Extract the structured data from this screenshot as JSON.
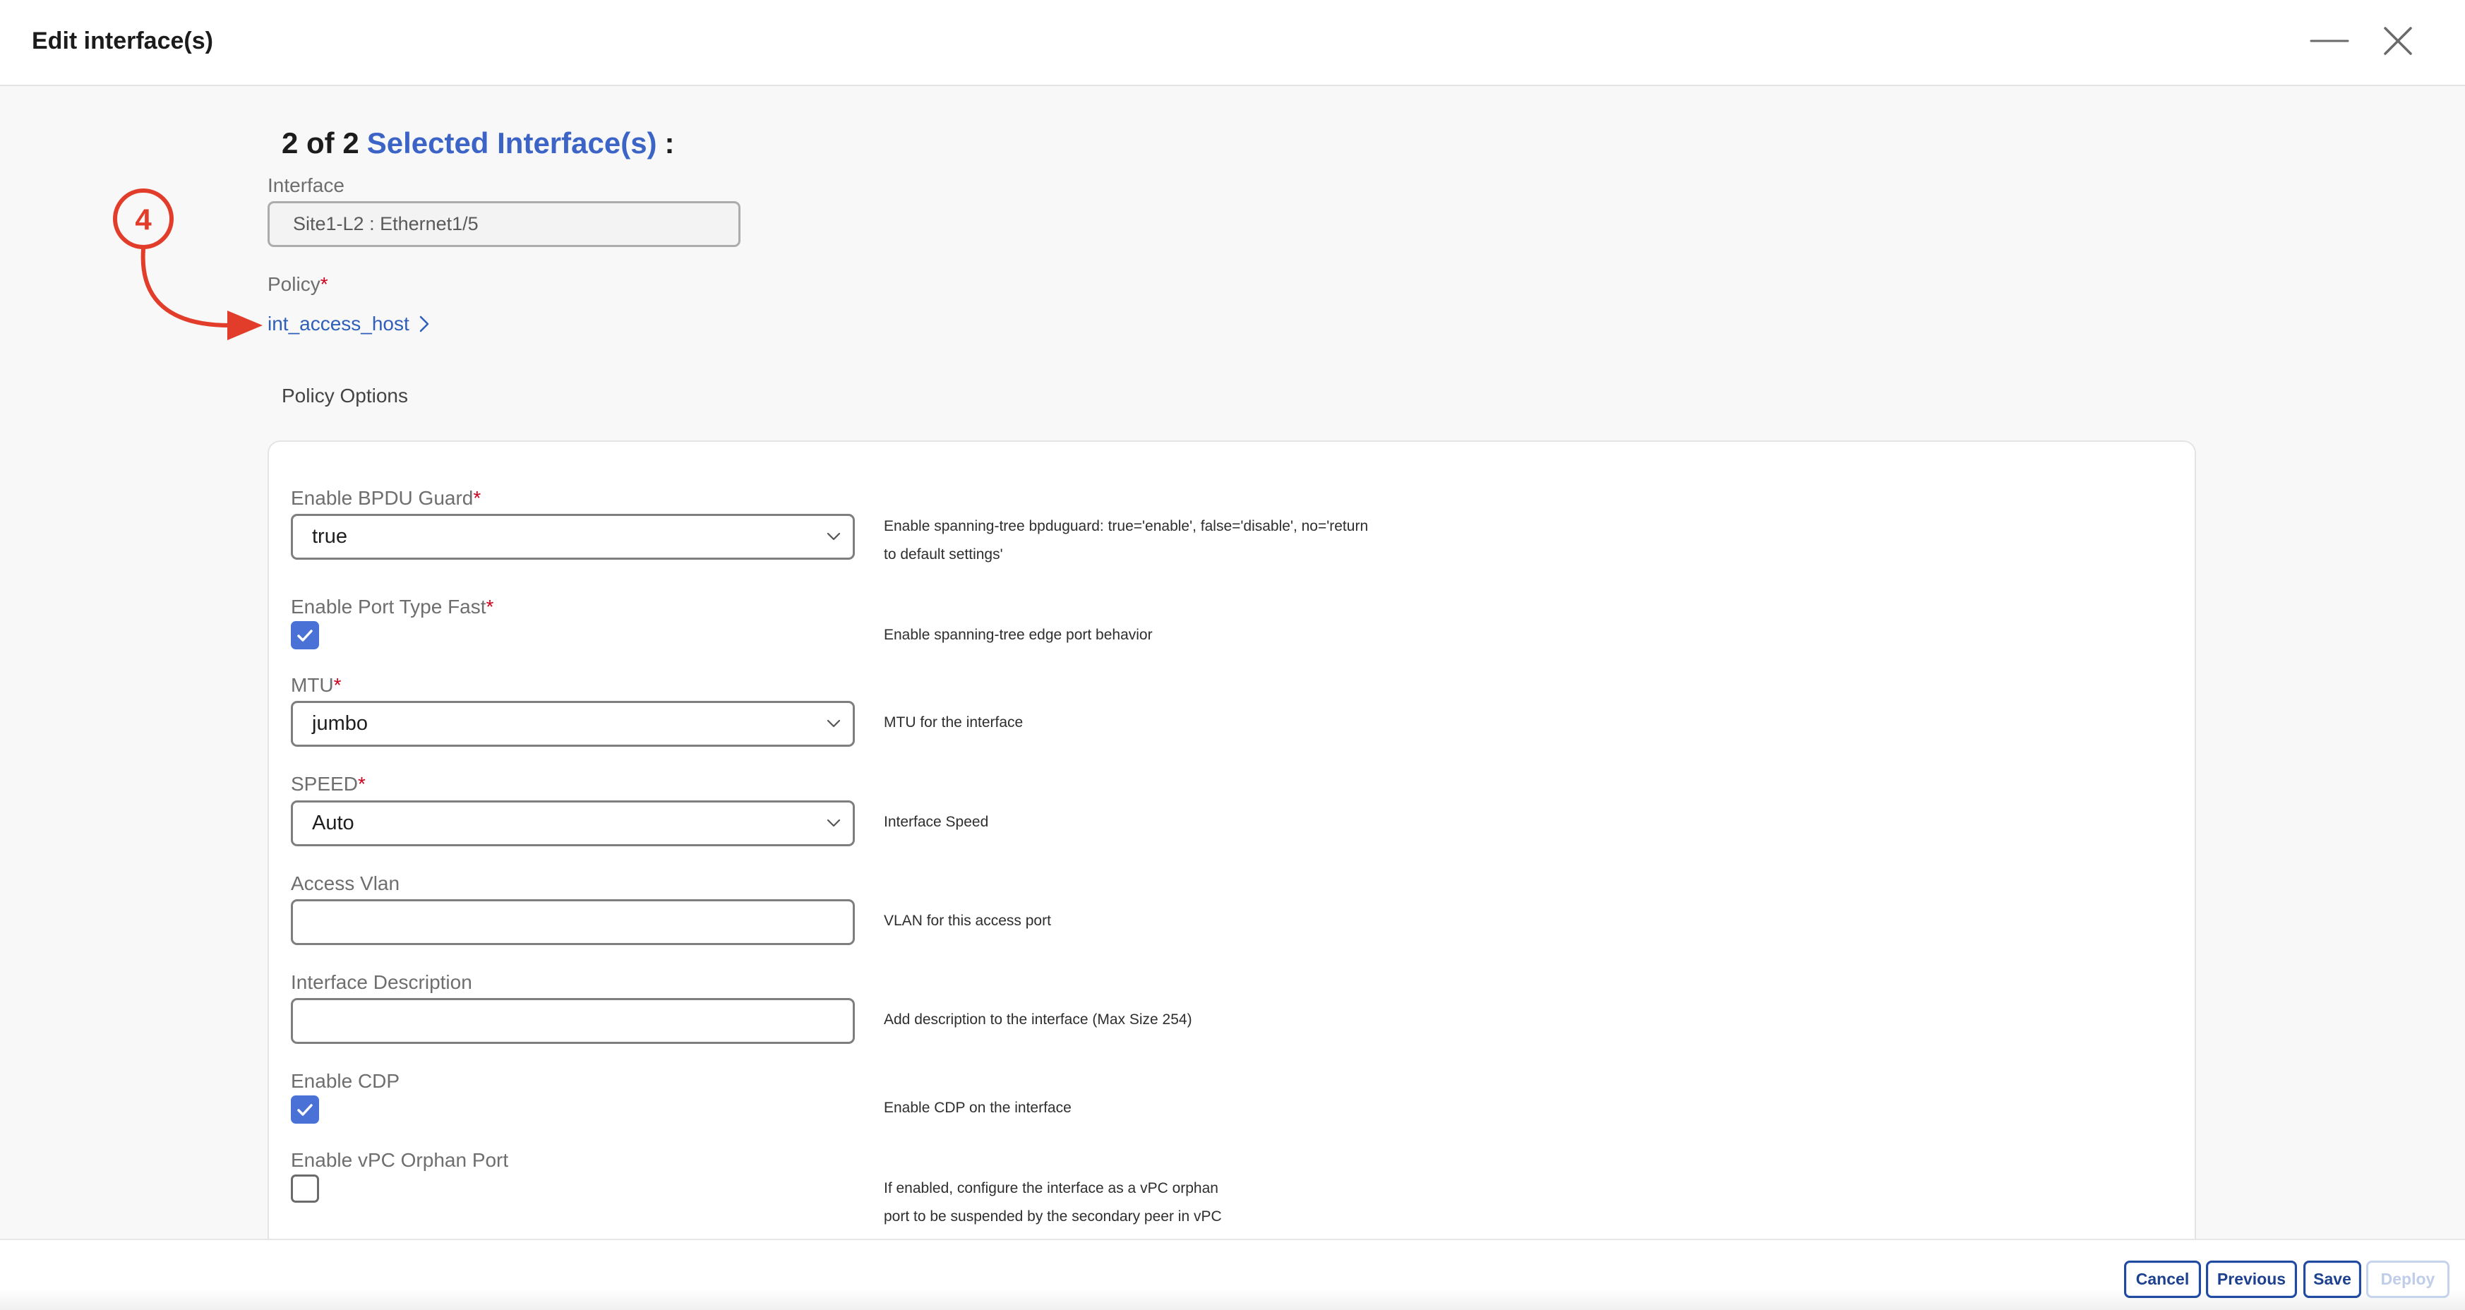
{
  "window": {
    "title": "Edit interface(s)",
    "minimize_icon": "minimize-icon",
    "close_icon": "close-icon"
  },
  "selection": {
    "count": "2 of 2",
    "link": "Selected Interface(s)",
    "suffix": ":"
  },
  "interface": {
    "label": "Interface",
    "value": "Site1-L2 : Ethernet1/5"
  },
  "policy": {
    "label": "Policy",
    "required": "*",
    "value": "int_access_host",
    "icon": "chevron-right-icon"
  },
  "annotation": {
    "step": "4"
  },
  "policy_options": {
    "heading": "Policy Options",
    "fields": [
      {
        "label": "Enable BPDU Guard",
        "required": "*",
        "value": "true",
        "icon": "chevron-down-icon",
        "help": [
          "Enable spanning-tree bpduguard: true='enable', false='disable', no='return",
          "to default settings'"
        ]
      },
      {
        "label": "Enable Port Type Fast",
        "required": "*",
        "checked": true,
        "icon": "check-icon",
        "help": [
          "Enable spanning-tree edge port behavior"
        ]
      },
      {
        "label": "MTU",
        "required": "*",
        "value": "jumbo",
        "icon": "chevron-down-icon",
        "help": [
          "MTU for the interface"
        ]
      },
      {
        "label": "SPEED",
        "required": "*",
        "value": "Auto",
        "icon": "chevron-down-icon",
        "help": [
          "Interface Speed"
        ]
      },
      {
        "label": "Access Vlan",
        "value": "",
        "help": [
          "VLAN for this access port"
        ]
      },
      {
        "label": "Interface Description",
        "value": "",
        "help": [
          "Add description to the interface (Max Size 254)"
        ]
      },
      {
        "label": "Enable CDP",
        "checked": true,
        "icon": "check-icon",
        "help": [
          "Enable CDP on the interface"
        ]
      },
      {
        "label": "Enable vPC Orphan Port",
        "checked": false,
        "help": [
          "If enabled, configure the interface as a vPC orphan",
          "port to be suspended by the secondary peer in vPC"
        ]
      }
    ]
  },
  "footer": {
    "cancel": "Cancel",
    "previous": "Previous",
    "save": "Save",
    "deploy": "Deploy",
    "deploy_disabled": true
  },
  "colors": {
    "accent": "#3b64c6",
    "link": "#2f5fb8",
    "required": "#d0021b",
    "annotation": "#e23d2b",
    "checkbox": "#4a72d6",
    "button": "#1f4aa0",
    "button_disabled": "#c6d3ec"
  }
}
